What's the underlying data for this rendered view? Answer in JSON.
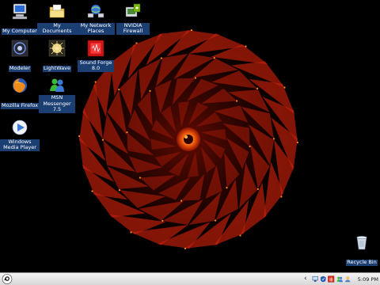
{
  "desktop": {
    "icons": [
      {
        "id": "my-computer",
        "label": "My Computer"
      },
      {
        "id": "my-documents",
        "label": "My Documents"
      },
      {
        "id": "my-network-places",
        "label": "My Network Places"
      },
      {
        "id": "nvidia-firewall",
        "label": "NVIDIA Firewall"
      },
      {
        "id": "modeler",
        "label": "Modeler"
      },
      {
        "id": "lightwave",
        "label": "LightWave"
      },
      {
        "id": "sound-forge",
        "label": "Sound Forge 8.0"
      },
      {
        "id": "mozilla-firefox",
        "label": "Mozilla Firefox"
      },
      {
        "id": "msn-messenger",
        "label": "MSN Messenger 7.5"
      },
      {
        "id": "windows-media-player",
        "label": "Windows Media Player"
      },
      {
        "id": "recycle-bin",
        "label": "Recycle Bin"
      }
    ]
  },
  "taskbar": {
    "tray_arrow": "‹",
    "clock": "5:09 PM"
  },
  "colors": {
    "desktop_bg": "#000000",
    "label_bg": "#1c3f73",
    "wallpaper_red": "#c8200a",
    "wallpaper_orange": "#ff8a1a"
  }
}
